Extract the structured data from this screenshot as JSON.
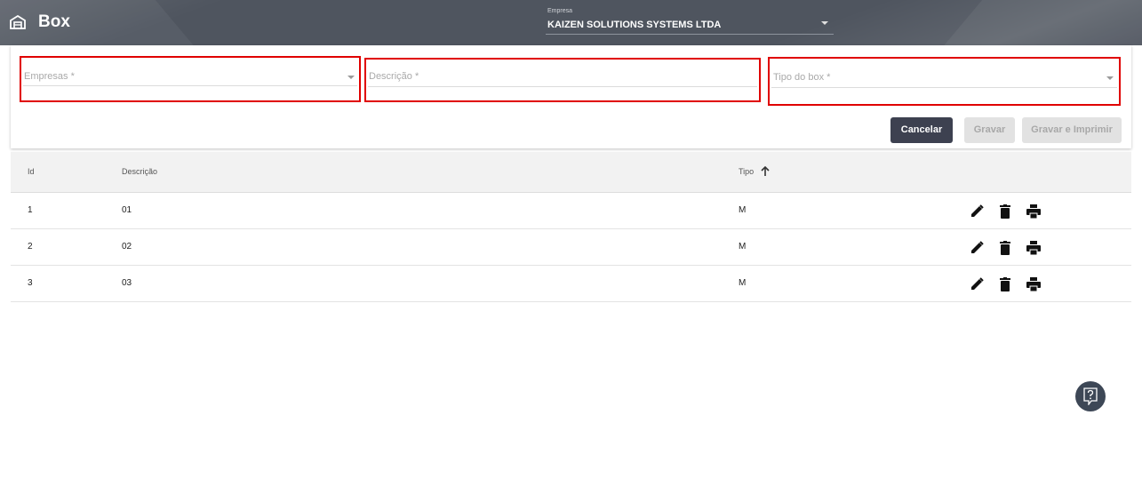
{
  "header": {
    "title": "Box",
    "company_label": "Empresa",
    "company_value": "KAIZEN SOLUTIONS SYSTEMS LTDA",
    "home_icon": "warehouse-icon"
  },
  "form": {
    "empresas_placeholder": "Empresas *",
    "descricao_placeholder": "Descrição *",
    "tipo_placeholder": "Tipo do box *",
    "cancel_label": "Cancelar",
    "save_label": "Gravar",
    "save_print_label": "Gravar e Imprimir"
  },
  "table": {
    "columns": [
      "Id",
      "Descrição",
      "Tipo"
    ],
    "sort_column": "Tipo",
    "sort_direction": "ascending",
    "rows": [
      {
        "id": "1",
        "descricao": "01",
        "tipo": "M"
      },
      {
        "id": "2",
        "descricao": "02",
        "tipo": "M"
      },
      {
        "id": "3",
        "descricao": "03",
        "tipo": "M"
      }
    ],
    "row_actions": [
      "edit-icon",
      "delete-icon",
      "print-icon"
    ]
  },
  "colors": {
    "header_bg": "#4f555f",
    "primary_button": "#3d4150",
    "highlight_border": "#e00000",
    "help_button": "#3d4756"
  }
}
